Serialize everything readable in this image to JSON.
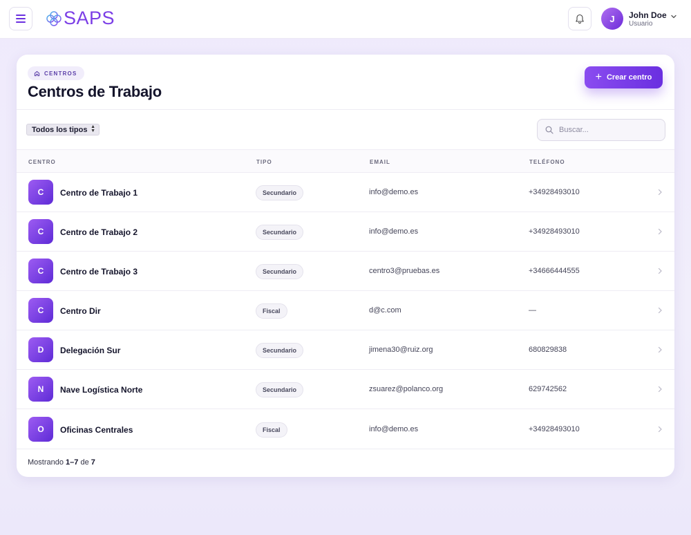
{
  "app": {
    "name": "SAPS"
  },
  "header": {
    "user_name": "John Doe",
    "user_role": "Usuario",
    "avatar_initial": "J"
  },
  "page": {
    "breadcrumb": "CENTROS",
    "title": "Centros de Trabajo",
    "create_button": "Crear centro"
  },
  "filters": {
    "type_select": "Todos los tipos",
    "search_placeholder": "Buscar..."
  },
  "table": {
    "headers": {
      "centro": "CENTRO",
      "tipo": "TIPO",
      "email": "EMAIL",
      "telefono": "TELÉFONO"
    },
    "rows": [
      {
        "initial": "C",
        "name": "Centro de Trabajo 1",
        "type": "Secundario",
        "email": "info@demo.es",
        "phone": "+34928493010"
      },
      {
        "initial": "C",
        "name": "Centro de Trabajo 2",
        "type": "Secundario",
        "email": "info@demo.es",
        "phone": "+34928493010"
      },
      {
        "initial": "C",
        "name": "Centro de Trabajo 3",
        "type": "Secundario",
        "email": "centro3@pruebas.es",
        "phone": "+34666444555"
      },
      {
        "initial": "C",
        "name": "Centro Dir",
        "type": "Fiscal",
        "email": "d@c.com",
        "phone": "—"
      },
      {
        "initial": "D",
        "name": "Delegación Sur",
        "type": "Secundario",
        "email": "jimena30@ruiz.org",
        "phone": "680829838"
      },
      {
        "initial": "N",
        "name": "Nave Logística Norte",
        "type": "Secundario",
        "email": "zsuarez@polanco.org",
        "phone": "629742562"
      },
      {
        "initial": "O",
        "name": "Oficinas Centrales",
        "type": "Fiscal",
        "email": "info@demo.es",
        "phone": "+34928493010"
      }
    ]
  },
  "pagination": {
    "prefix": "Mostrando",
    "range": "1–7",
    "of": "de",
    "total": "7"
  },
  "colors": {
    "accent": "#7b3ee6",
    "accent_dark": "#6a2fe0"
  },
  "icons": [
    "menu-icon",
    "logo-icon",
    "bell-icon",
    "chevron-down-icon",
    "home-icon",
    "plus-icon",
    "search-icon",
    "chevron-right-icon"
  ]
}
